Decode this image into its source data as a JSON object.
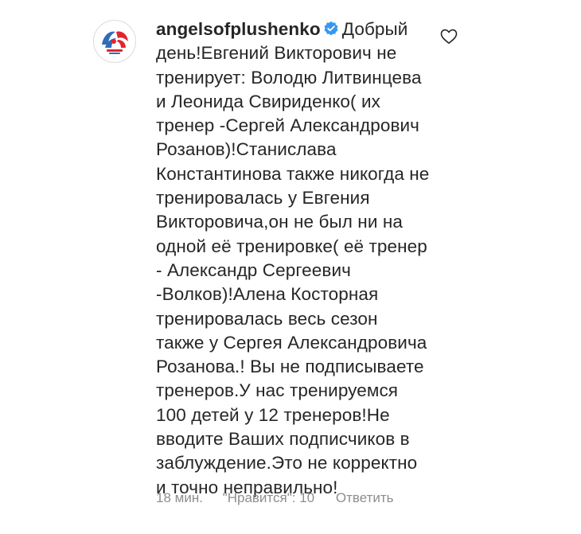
{
  "comment": {
    "username": "angelsofplushenko",
    "verified": true,
    "text": "Добрый день!Евгений Викторович не тренирует: Володю Литвинцева и Леонида Свириденко( их тренер -Сергей Александрович Розанов)!Станислава Константинова также никогда не тренировалась у Евгения Викторовича,он не был ни на одной её тренировке( её тренер - Александр Сергеевич -Волков)!Алена Косторная тренировалась весь сезон также у Сергея Александровича Розанова.! Вы не подписываете тренеров.У нас тренируемся 100 детей у 12 тренеров!Не вводите Ваших подписчиков в заблуждение.Это не корректно и точно неправильно!",
    "time": "18 мин.",
    "likes": "\"Нравится\": 10",
    "reply_label": "Ответить"
  },
  "icons": {
    "avatar": "angels-of-plushenko-logo",
    "verified": "verified-badge-icon",
    "like": "heart-outline-icon"
  },
  "colors": {
    "text": "#262626",
    "meta": "#8e8e8e",
    "verified_blue": "#3897f0",
    "logo_red": "#e0262d",
    "logo_blue": "#2f6db5"
  }
}
